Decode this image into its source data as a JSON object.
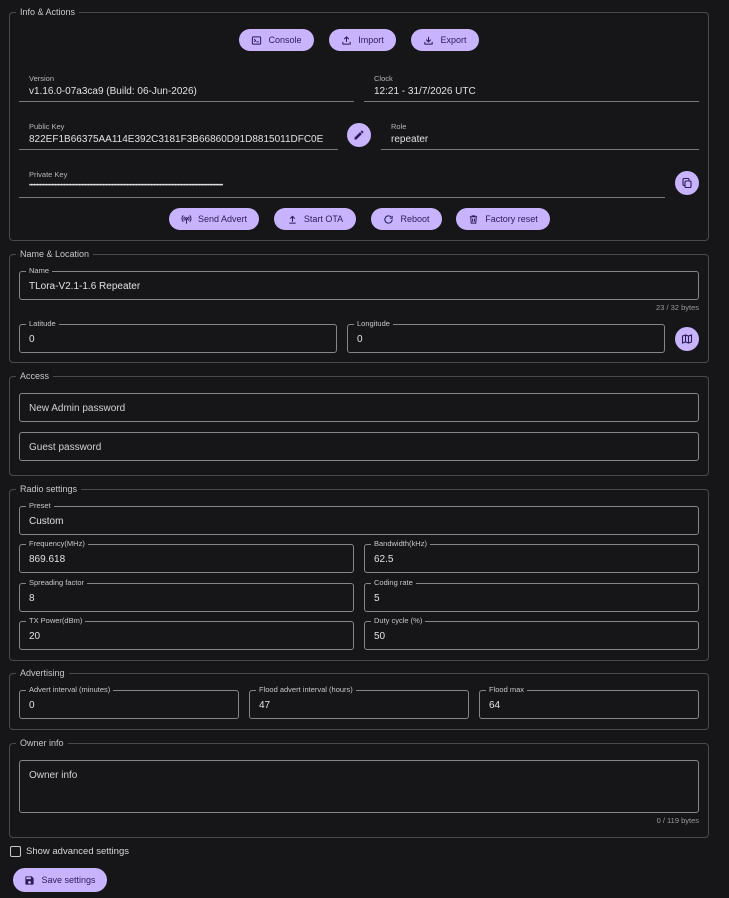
{
  "info": {
    "legend": "Info & Actions",
    "console_label": "Console",
    "import_label": "Import",
    "export_label": "Export",
    "version_label": "Version",
    "version_value": "v1.16.0-07a3ca9 (Build: 06-Jun-2026)",
    "clock_label": "Clock",
    "clock_value": "12:21 - 31/7/2026 UTC",
    "pubkey_label": "Public Key",
    "pubkey_value": "822EF1B66375AA114E392C3181F3B66860D91D8815011DFC0E",
    "role_label": "Role",
    "role_value": "repeater",
    "privkey_label": "Private Key",
    "privkey_value": "•••••••••••••••••••••••••••••••••••••••••••••••••••••••••••••••••••••••••••••••••••••••••••••••••••••••••••••••••••••••••••••••••",
    "send_advert_label": "Send Advert",
    "start_ota_label": "Start OTA",
    "reboot_label": "Reboot",
    "factory_reset_label": "Factory reset"
  },
  "name_location": {
    "legend": "Name & Location",
    "name_label": "Name",
    "name_value": "TLora-V2.1-1.6 Repeater",
    "name_counter": "23 / 32 bytes",
    "lat_label": "Latitude",
    "lat_value": "0",
    "lon_label": "Longitude",
    "lon_value": "0"
  },
  "access": {
    "legend": "Access",
    "admin_placeholder": "New Admin password",
    "guest_placeholder": "Guest password"
  },
  "radio": {
    "legend": "Radio settings",
    "preset_label": "Preset",
    "preset_value": "Custom",
    "freq_label": "Frequency(MHz)",
    "freq_value": "869.618",
    "bw_label": "Bandwidth(kHz)",
    "bw_value": "62.5",
    "sf_label": "Spreading factor",
    "sf_value": "8",
    "cr_label": "Coding rate",
    "cr_value": "5",
    "tx_label": "TX Power(dBm)",
    "tx_value": "20",
    "duty_label": "Duty cycle (%)",
    "duty_value": "50"
  },
  "advertising": {
    "legend": "Advertising",
    "advert_interval_label": "Advert interval (minutes)",
    "advert_interval_value": "0",
    "flood_interval_label": "Flood advert interval (hours)",
    "flood_interval_value": "47",
    "flood_max_label": "Flood max",
    "flood_max_value": "64"
  },
  "owner": {
    "legend": "Owner info",
    "placeholder": "Owner info",
    "counter": "0 / 119 bytes"
  },
  "footer": {
    "advanced_label": "Show advanced settings",
    "save_label": "Save settings"
  },
  "colors": {
    "accent": "#c8b3ff",
    "background": "#161618"
  }
}
